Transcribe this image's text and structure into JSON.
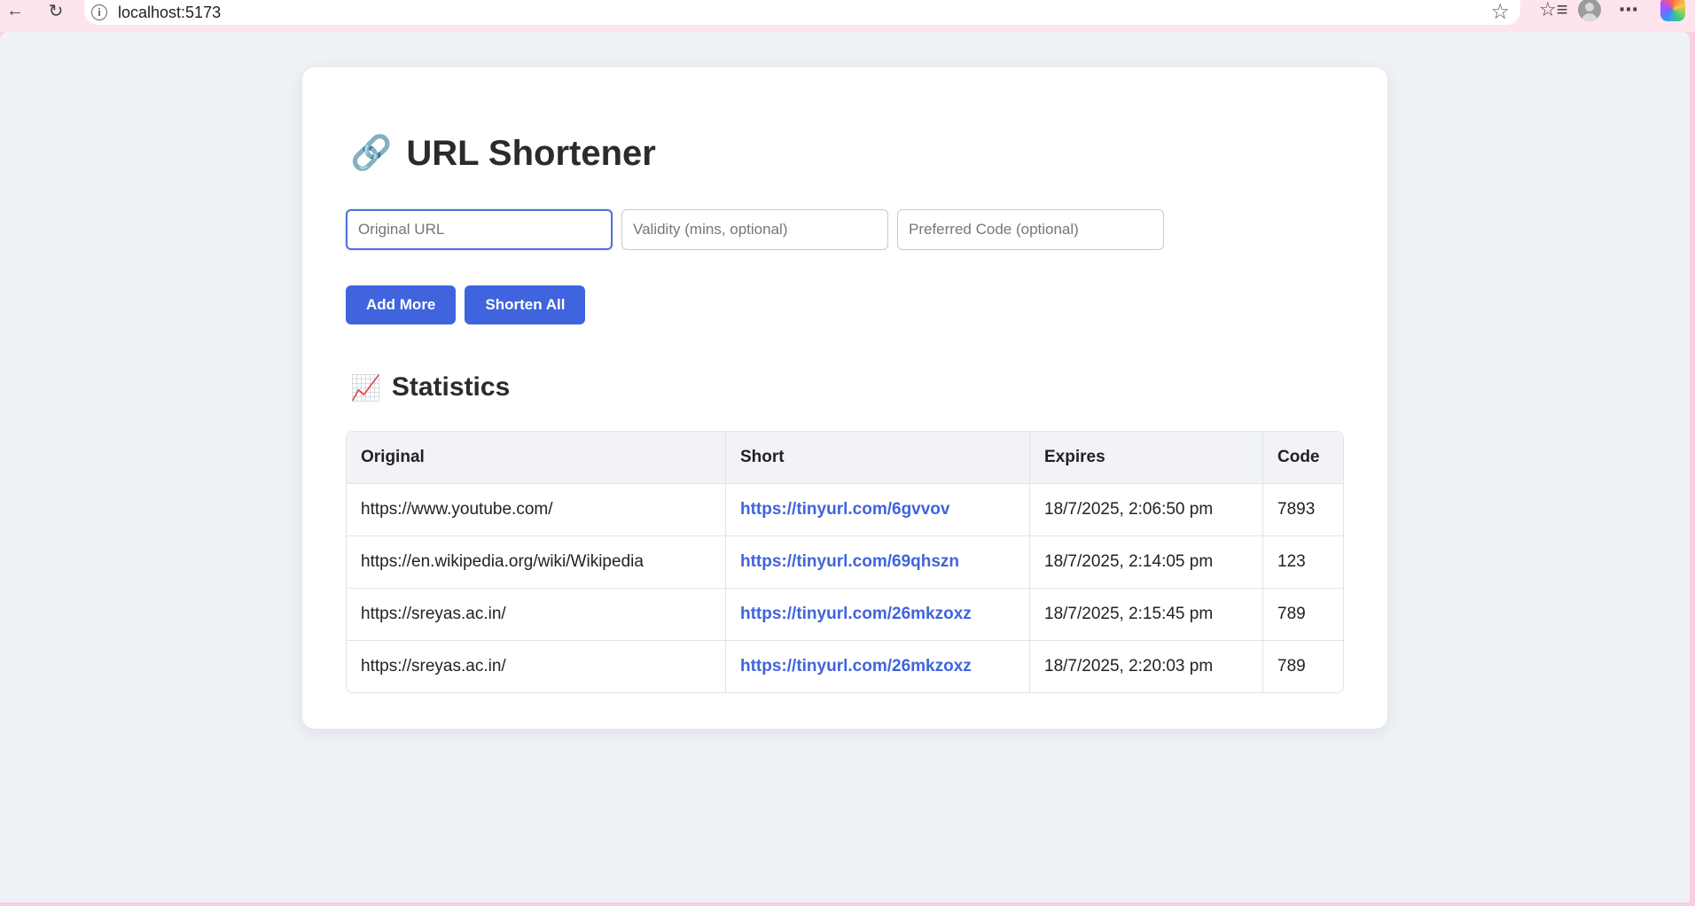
{
  "browser": {
    "url": "localhost:5173",
    "icons": {
      "back": "arrow-left-icon",
      "reload": "reload-icon",
      "info": "info-icon",
      "favorite": "star-icon",
      "favorites_list": "favorites-icon",
      "profile": "avatar-icon",
      "menu": "more-icon",
      "copilot": "copilot-icon"
    }
  },
  "app": {
    "title": "URL Shortener",
    "title_emoji": "🔗",
    "form": {
      "original_url_placeholder": "Original URL",
      "validity_placeholder": "Validity (mins, optional)",
      "preferred_code_placeholder": "Preferred Code (optional)"
    },
    "buttons": {
      "add_more": "Add More",
      "shorten_all": "Shorten All"
    },
    "statistics": {
      "title": "Statistics",
      "title_emoji": "📈",
      "headers": [
        "Original",
        "Short",
        "Expires",
        "Code"
      ],
      "rows": [
        {
          "original": "https://www.youtube.com/",
          "short": "https://tinyurl.com/6gvvov",
          "expires": "18/7/2025, 2:06:50 pm",
          "code": "7893"
        },
        {
          "original": "https://en.wikipedia.org/wiki/Wikipedia",
          "short": "https://tinyurl.com/69qhszn",
          "expires": "18/7/2025, 2:14:05 pm",
          "code": "123"
        },
        {
          "original": "https://sreyas.ac.in/",
          "short": "https://tinyurl.com/26mkzoxz",
          "expires": "18/7/2025, 2:15:45 pm",
          "code": "789"
        },
        {
          "original": "https://sreyas.ac.in/",
          "short": "https://tinyurl.com/26mkzoxz",
          "expires": "18/7/2025, 2:20:03 pm",
          "code": "789"
        }
      ]
    }
  },
  "colors": {
    "accent": "#3f64dd",
    "browser_frame": "#f6cfe0",
    "page_background": "#eef1f5"
  }
}
